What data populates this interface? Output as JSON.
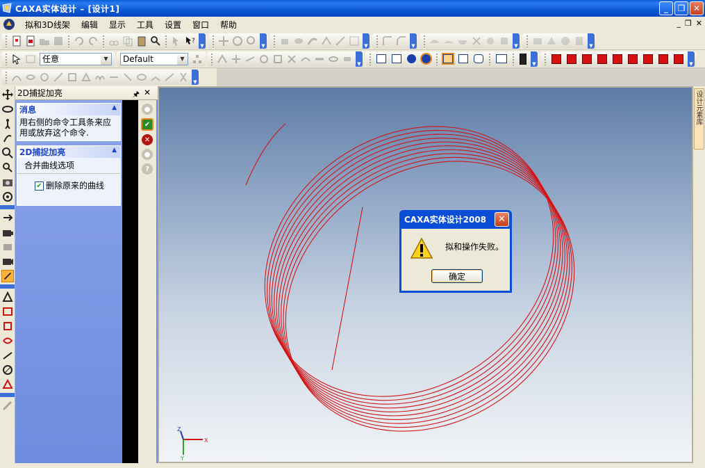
{
  "window": {
    "title": "CAXA实体设计 – [设计1]",
    "buttons": [
      "_",
      "❐",
      "✕"
    ]
  },
  "menubar": {
    "items": [
      "拟和3D线架",
      "编辑",
      "显示",
      "工具",
      "设置",
      "窗口",
      "帮助"
    ],
    "mdi_controls": [
      "_",
      "❐",
      "✕"
    ]
  },
  "toolbar": {
    "filter_combo": "任意",
    "style_combo": "Default"
  },
  "panel": {
    "title": "2D捕捉加亮",
    "pin_icon": "pin-icon",
    "close_label": "✕",
    "message_group": {
      "header": "消息",
      "text": "用右侧的命令工具条来应用或放弃这个命令."
    },
    "snap_group": {
      "header": "2D捕捉加亮",
      "subheader": "合并曲线选项",
      "checkbox_label": "删除原来的曲线",
      "checked": true
    }
  },
  "rightstrip": {
    "tab_label": "设计元素库"
  },
  "dialog": {
    "title": "CAXA实体设计2008",
    "message": "拟和操作失败。",
    "ok_label": "确定",
    "icon": "warning-icon"
  },
  "axis": {
    "x_label": "X",
    "y_label": "Y",
    "z_label": "Z"
  },
  "colors": {
    "titlebar": "#0b56d4",
    "curve": "#d31313",
    "panel": "#6f8ee0"
  }
}
